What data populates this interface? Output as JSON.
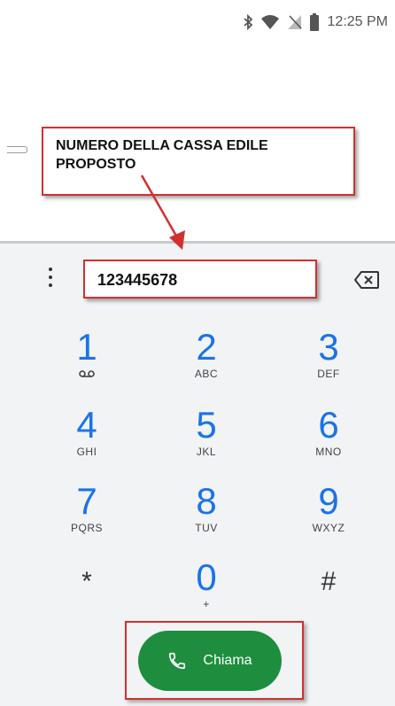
{
  "status_bar": {
    "time": "12:25 PM",
    "icons": [
      "bluetooth-icon",
      "wifi-icon",
      "no-sim-icon",
      "battery-icon"
    ]
  },
  "annotation": {
    "callout_text": "NUMERO DELLA CASSA EDILE PROPOSTO"
  },
  "dialer": {
    "number": "123445678",
    "menu_icon": "more-vert-icon",
    "backspace_icon": "backspace-icon",
    "keys": [
      {
        "digit": "1",
        "letters": ""
      },
      {
        "digit": "2",
        "letters": "ABC"
      },
      {
        "digit": "3",
        "letters": "DEF"
      },
      {
        "digit": "4",
        "letters": "GHI"
      },
      {
        "digit": "5",
        "letters": "JKL"
      },
      {
        "digit": "6",
        "letters": "MNO"
      },
      {
        "digit": "7",
        "letters": "PQRS"
      },
      {
        "digit": "8",
        "letters": "TUV"
      },
      {
        "digit": "9",
        "letters": "WXYZ"
      },
      {
        "digit": "*",
        "letters": ""
      },
      {
        "digit": "0",
        "letters": "+"
      },
      {
        "digit": "#",
        "letters": ""
      }
    ],
    "call_label": "Chiama"
  },
  "colors": {
    "accent": "#1a73e8",
    "call_green": "#1e8e3e",
    "annotation_red": "#d32f2f"
  }
}
